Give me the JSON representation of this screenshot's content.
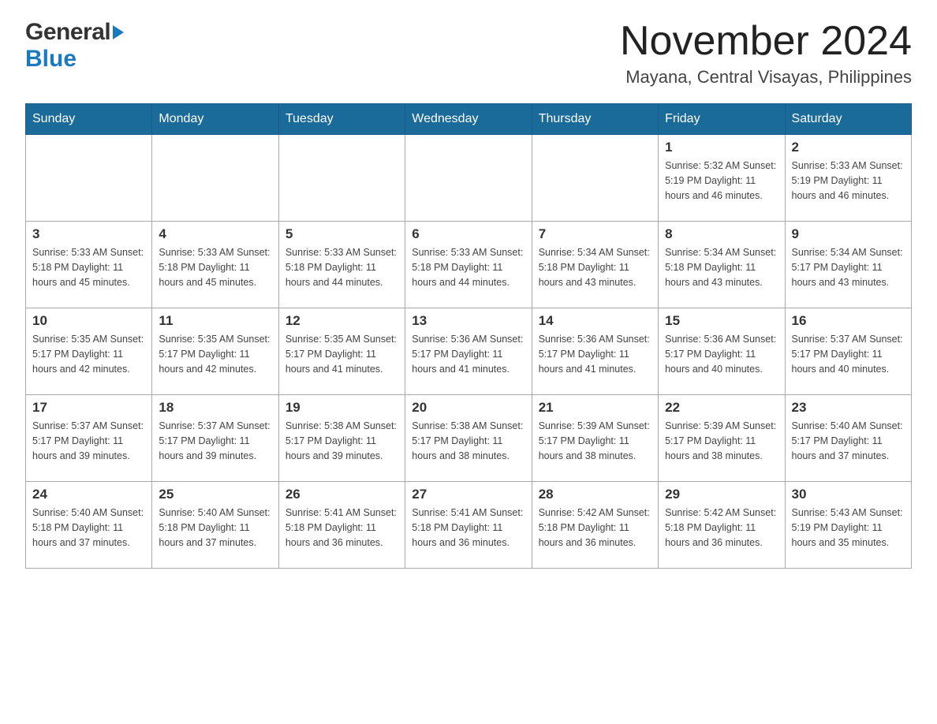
{
  "header": {
    "logo": {
      "general_text": "General",
      "blue_text": "Blue"
    },
    "title": "November 2024",
    "location": "Mayana, Central Visayas, Philippines"
  },
  "calendar": {
    "days_of_week": [
      "Sunday",
      "Monday",
      "Tuesday",
      "Wednesday",
      "Thursday",
      "Friday",
      "Saturday"
    ],
    "weeks": [
      {
        "days": [
          {
            "number": "",
            "info": ""
          },
          {
            "number": "",
            "info": ""
          },
          {
            "number": "",
            "info": ""
          },
          {
            "number": "",
            "info": ""
          },
          {
            "number": "",
            "info": ""
          },
          {
            "number": "1",
            "info": "Sunrise: 5:32 AM\nSunset: 5:19 PM\nDaylight: 11 hours and 46 minutes."
          },
          {
            "number": "2",
            "info": "Sunrise: 5:33 AM\nSunset: 5:19 PM\nDaylight: 11 hours and 46 minutes."
          }
        ]
      },
      {
        "days": [
          {
            "number": "3",
            "info": "Sunrise: 5:33 AM\nSunset: 5:18 PM\nDaylight: 11 hours and 45 minutes."
          },
          {
            "number": "4",
            "info": "Sunrise: 5:33 AM\nSunset: 5:18 PM\nDaylight: 11 hours and 45 minutes."
          },
          {
            "number": "5",
            "info": "Sunrise: 5:33 AM\nSunset: 5:18 PM\nDaylight: 11 hours and 44 minutes."
          },
          {
            "number": "6",
            "info": "Sunrise: 5:33 AM\nSunset: 5:18 PM\nDaylight: 11 hours and 44 minutes."
          },
          {
            "number": "7",
            "info": "Sunrise: 5:34 AM\nSunset: 5:18 PM\nDaylight: 11 hours and 43 minutes."
          },
          {
            "number": "8",
            "info": "Sunrise: 5:34 AM\nSunset: 5:18 PM\nDaylight: 11 hours and 43 minutes."
          },
          {
            "number": "9",
            "info": "Sunrise: 5:34 AM\nSunset: 5:17 PM\nDaylight: 11 hours and 43 minutes."
          }
        ]
      },
      {
        "days": [
          {
            "number": "10",
            "info": "Sunrise: 5:35 AM\nSunset: 5:17 PM\nDaylight: 11 hours and 42 minutes."
          },
          {
            "number": "11",
            "info": "Sunrise: 5:35 AM\nSunset: 5:17 PM\nDaylight: 11 hours and 42 minutes."
          },
          {
            "number": "12",
            "info": "Sunrise: 5:35 AM\nSunset: 5:17 PM\nDaylight: 11 hours and 41 minutes."
          },
          {
            "number": "13",
            "info": "Sunrise: 5:36 AM\nSunset: 5:17 PM\nDaylight: 11 hours and 41 minutes."
          },
          {
            "number": "14",
            "info": "Sunrise: 5:36 AM\nSunset: 5:17 PM\nDaylight: 11 hours and 41 minutes."
          },
          {
            "number": "15",
            "info": "Sunrise: 5:36 AM\nSunset: 5:17 PM\nDaylight: 11 hours and 40 minutes."
          },
          {
            "number": "16",
            "info": "Sunrise: 5:37 AM\nSunset: 5:17 PM\nDaylight: 11 hours and 40 minutes."
          }
        ]
      },
      {
        "days": [
          {
            "number": "17",
            "info": "Sunrise: 5:37 AM\nSunset: 5:17 PM\nDaylight: 11 hours and 39 minutes."
          },
          {
            "number": "18",
            "info": "Sunrise: 5:37 AM\nSunset: 5:17 PM\nDaylight: 11 hours and 39 minutes."
          },
          {
            "number": "19",
            "info": "Sunrise: 5:38 AM\nSunset: 5:17 PM\nDaylight: 11 hours and 39 minutes."
          },
          {
            "number": "20",
            "info": "Sunrise: 5:38 AM\nSunset: 5:17 PM\nDaylight: 11 hours and 38 minutes."
          },
          {
            "number": "21",
            "info": "Sunrise: 5:39 AM\nSunset: 5:17 PM\nDaylight: 11 hours and 38 minutes."
          },
          {
            "number": "22",
            "info": "Sunrise: 5:39 AM\nSunset: 5:17 PM\nDaylight: 11 hours and 38 minutes."
          },
          {
            "number": "23",
            "info": "Sunrise: 5:40 AM\nSunset: 5:17 PM\nDaylight: 11 hours and 37 minutes."
          }
        ]
      },
      {
        "days": [
          {
            "number": "24",
            "info": "Sunrise: 5:40 AM\nSunset: 5:18 PM\nDaylight: 11 hours and 37 minutes."
          },
          {
            "number": "25",
            "info": "Sunrise: 5:40 AM\nSunset: 5:18 PM\nDaylight: 11 hours and 37 minutes."
          },
          {
            "number": "26",
            "info": "Sunrise: 5:41 AM\nSunset: 5:18 PM\nDaylight: 11 hours and 36 minutes."
          },
          {
            "number": "27",
            "info": "Sunrise: 5:41 AM\nSunset: 5:18 PM\nDaylight: 11 hours and 36 minutes."
          },
          {
            "number": "28",
            "info": "Sunrise: 5:42 AM\nSunset: 5:18 PM\nDaylight: 11 hours and 36 minutes."
          },
          {
            "number": "29",
            "info": "Sunrise: 5:42 AM\nSunset: 5:18 PM\nDaylight: 11 hours and 36 minutes."
          },
          {
            "number": "30",
            "info": "Sunrise: 5:43 AM\nSunset: 5:19 PM\nDaylight: 11 hours and 35 minutes."
          }
        ]
      }
    ]
  }
}
